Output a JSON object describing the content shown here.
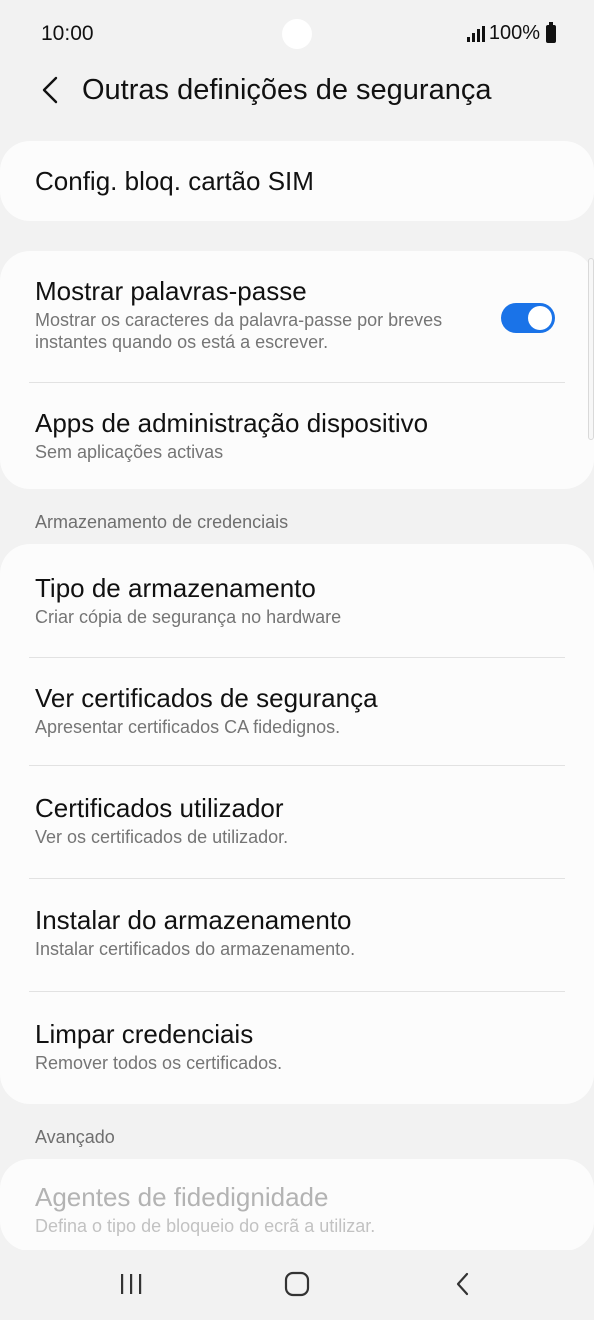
{
  "status_bar": {
    "time": "10:00",
    "battery": "100%"
  },
  "header": {
    "title": "Outras definições de segurança"
  },
  "sim_card": {
    "title": "Config. bloq. cartão SIM"
  },
  "group1": {
    "show_passwords": {
      "title": "Mostrar palavras-passe",
      "subtitle": "Mostrar os caracteres da palavra-passe por breves instantes quando os está a escrever.",
      "enabled": true
    },
    "device_admin": {
      "title": "Apps de administração dispositivo",
      "subtitle": "Sem aplicações activas"
    }
  },
  "credentials": {
    "section_label": "Armazenamento de credenciais",
    "items": [
      {
        "title": "Tipo de armazenamento",
        "subtitle": "Criar cópia de segurança no hardware"
      },
      {
        "title": "Ver certificados de segurança",
        "subtitle": "Apresentar certificados CA fidedignos."
      },
      {
        "title": "Certificados utilizador",
        "subtitle": "Ver os certificados de utilizador."
      },
      {
        "title": "Instalar do armazenamento",
        "subtitle": "Instalar certificados do armazenamento."
      },
      {
        "title": "Limpar credenciais",
        "subtitle": "Remover todos os certificados."
      }
    ]
  },
  "advanced": {
    "section_label": "Avançado",
    "trust_agents": {
      "title": "Agentes de fidedignidade",
      "subtitle": "Defina o tipo de bloqueio do ecrã a utilizar."
    }
  },
  "colors": {
    "accent": "#1a73e8",
    "background": "#f2f2f2",
    "card": "#fcfcfc"
  }
}
